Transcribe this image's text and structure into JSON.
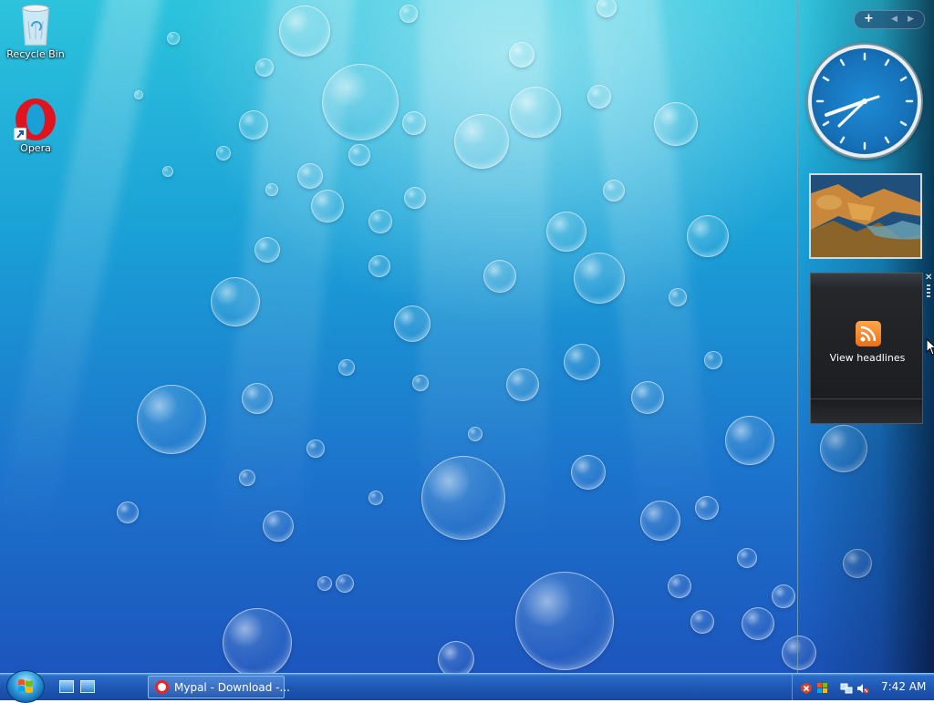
{
  "desktop": {
    "icons": [
      {
        "label": "Recycle Bin",
        "icon": "recycle-bin-icon"
      },
      {
        "label": "Opera",
        "icon": "opera-icon"
      }
    ]
  },
  "sidebar": {
    "controls": {
      "add": "+",
      "prev": "◀",
      "next": "▶"
    },
    "feeds_gadget": {
      "label": "View headlines",
      "close": "✕"
    },
    "clock_time": "7:42"
  },
  "taskbar": {
    "task": {
      "label": "Mypal - Download -..."
    },
    "clock": "7:42 AM"
  },
  "colors": {
    "taskbar": "#1e58b4",
    "rss": "#f28a2a",
    "desktop": "#1aa0d6"
  }
}
